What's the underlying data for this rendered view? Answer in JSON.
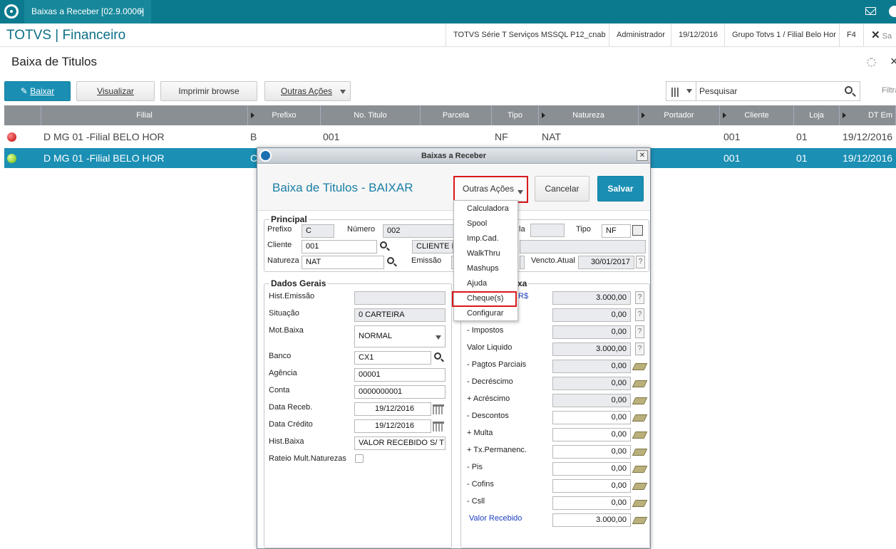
{
  "tabbar": {
    "tab_label": "Baixas a Receber [02.9.0006]",
    "tab_close": "×"
  },
  "header": {
    "app_title": "TOTVS | Financeiro",
    "environment": "TOTVS Série T Serviços MSSQL P12_cnab",
    "user": "Administrador",
    "date": "19/12/2016",
    "branch": "Grupo Totvs 1 / Filial Belo Hor",
    "shortcut": "F4",
    "exit_label": "Sa"
  },
  "page": {
    "title": "Baixa de Titulos",
    "close": "×"
  },
  "toolbar": {
    "baixar": "Baixar",
    "visualizar": "Visualizar",
    "imprimir": "Imprimir browse",
    "outras": "Outras Ações",
    "search_placeholder": "Pesquisar",
    "filtrar": "Filtra"
  },
  "grid": {
    "columns": [
      "Filial",
      "Prefixo",
      "No. Titulo",
      "Parcela",
      "Tipo",
      "Natureza",
      "Portador",
      "Cliente",
      "Loja",
      "DT Em"
    ],
    "rows": [
      {
        "filial": "D MG 01 -Filial BELO HOR",
        "prefixo": "B",
        "titulo": "001",
        "parcela": "",
        "tipo": "NF",
        "natureza": "NAT",
        "portador": "",
        "cliente": "001",
        "loja": "01",
        "dt": "19/12/2016",
        "status": "red"
      },
      {
        "filial": "D MG 01 -Filial BELO HOR",
        "prefixo": "C",
        "titulo": "",
        "parcela": "",
        "tipo": "",
        "natureza": "",
        "portador": "",
        "cliente": "001",
        "loja": "01",
        "dt": "19/12/2016",
        "status": "green"
      }
    ]
  },
  "dialog": {
    "window_title": "Baixas a Receber",
    "title": "Baixa de Titulos - BAIXAR",
    "outras": "Outras Ações",
    "cancelar": "Cancelar",
    "salvar": "Salvar",
    "principal": {
      "legend": "Principal",
      "prefixo_label": "Prefixo",
      "prefixo": "C",
      "numero_label": "Número",
      "numero": "002",
      "parcela_label": "la",
      "parcela": "",
      "tipo_label": "Tipo",
      "tipo": "NF",
      "cliente_label": "Cliente",
      "cliente": "001",
      "cliente_nome": "CLIENTE PE",
      "natureza_label": "Natureza",
      "natureza": "NAT",
      "emissao_label": "Emissão",
      "vencto_label": "Vencto.Atual",
      "vencto": "30/01/2017"
    },
    "dados_gerais": {
      "legend": "Dados Gerais",
      "hist_emissao_label": "Hist.Emissão",
      "hist_emissao": "",
      "situacao_label": "Situação",
      "situacao": "0 CARTEIRA",
      "motbaixa_label": "Mot.Baixa",
      "motbaixa": "NORMAL",
      "banco_label": "Banco",
      "banco": "CX1",
      "agencia_label": "Agência",
      "agencia": "00001",
      "conta_label": "Conta",
      "conta": "0000000001",
      "data_receb_label": "Data Receb.",
      "data_receb": "19/12/2016",
      "data_credito_label": "Data Crédito",
      "data_credito": "19/12/2016",
      "hist_baixa_label": "Hist.Baixa",
      "hist_baixa": "VALOR RECEBIDO S/ TIT",
      "rateio_label": "Rateio Mult.Naturezas"
    },
    "baixa": {
      "legend": "xa",
      "top_label": "R$",
      "rows": [
        {
          "label": "",
          "value": "3.000,00",
          "ro": true,
          "btn": "q"
        },
        {
          "label": "",
          "value": "0,00",
          "ro": true,
          "btn": "q"
        },
        {
          "label": "- Impostos",
          "value": "0,00",
          "ro": true,
          "btn": "q"
        },
        {
          "label": "Valor Liquido",
          "value": "3.000,00",
          "ro": true,
          "btn": "q"
        },
        {
          "label": "- Pagtos Parciais",
          "value": "0,00",
          "ro": true,
          "btn": "m"
        },
        {
          "label": "- Decréscimo",
          "value": "0,00",
          "ro": true,
          "btn": "m"
        },
        {
          "label": "+ Acréscimo",
          "value": "0,00",
          "ro": true,
          "btn": "m"
        },
        {
          "label": "- Descontos",
          "value": "0,00",
          "ro": false,
          "btn": "m"
        },
        {
          "label": "+ Multa",
          "value": "0,00",
          "ro": false,
          "btn": "m"
        },
        {
          "label": "+ Tx.Permanenc.",
          "value": "0,00",
          "ro": false,
          "btn": "m"
        },
        {
          "label": "- Pis",
          "value": "0,00",
          "ro": false,
          "btn": "m"
        },
        {
          "label": "- Cofins",
          "value": "0,00",
          "ro": false,
          "btn": "m"
        },
        {
          "label": "- Csll",
          "value": "0,00",
          "ro": false,
          "btn": "m"
        },
        {
          "label": "Valor Recebido",
          "value": "3.000,00",
          "ro": false,
          "btn": "m",
          "blue": true
        }
      ]
    }
  },
  "menu": {
    "items": [
      "Calculadora",
      "Spool",
      "Imp.Cad.",
      "WalkThru",
      "Mashups",
      "Ajuda",
      "Cheque(s)",
      "Configurar"
    ]
  },
  "colors": {
    "teal": "#0c7a8e",
    "blue": "#1a8fb3",
    "highlight": "#d9191c"
  }
}
